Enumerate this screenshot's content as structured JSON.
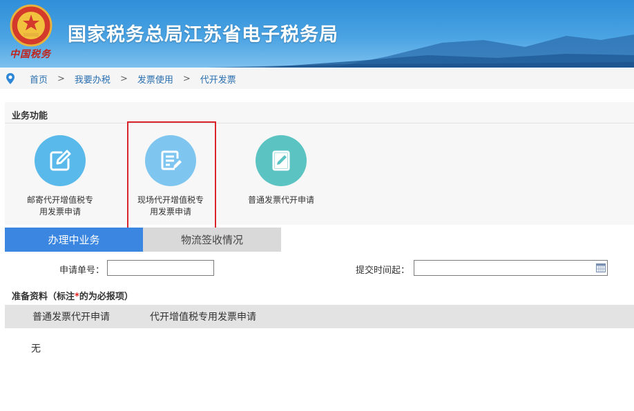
{
  "header": {
    "title": "国家税务总局江苏省电子税务局",
    "logo_script": "中国税务",
    "emblem_icon": "tax-emblem-icon",
    "colors": {
      "banner_top": "#2f8fd8",
      "banner_bottom": "#7cc0ee"
    }
  },
  "breadcrumb": {
    "items": [
      "首页",
      "我要办税",
      "发票使用",
      "代开发票"
    ],
    "separator": ">"
  },
  "business": {
    "title": "业务功能",
    "items": [
      {
        "label_line1": "邮寄代开增值税专",
        "label_line2": "用发票申请",
        "icon": "edit-icon",
        "color": "#59b9ea"
      },
      {
        "label_line1": "现场代开增值税专",
        "label_line2": "用发票申请",
        "icon": "document-edit-icon",
        "color": "#7ec6ef"
      },
      {
        "label_line1": "普通发票代开申请",
        "label_line2": "",
        "icon": "notebook-edit-icon",
        "color": "#5cc3c3"
      }
    ],
    "highlight_color": "#d9242a"
  },
  "tabs": {
    "items": [
      "办理中业务",
      "物流签收情况"
    ],
    "active": "办理中业务",
    "active_color": "#3a86e0"
  },
  "form": {
    "application_no_label": "申请单号：",
    "application_no_value": "",
    "submit_time_label": "提交时间起：",
    "submit_time_value": ""
  },
  "materials": {
    "title_prefix": "准备资料（标注",
    "required_mark": "*",
    "title_suffix": "的为必报项）",
    "sub_tabs": [
      "普通发票代开申请",
      "代开增值税专用发票申请"
    ],
    "content": "无"
  }
}
